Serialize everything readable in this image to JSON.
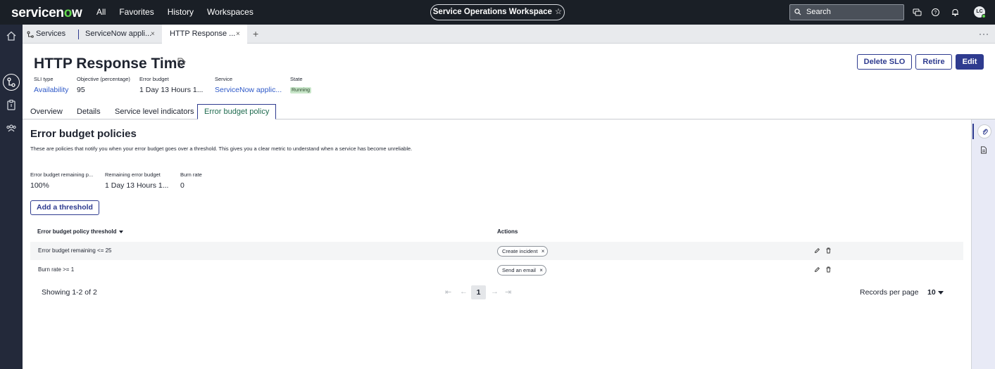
{
  "app": {
    "logo_text_a": "servicen",
    "logo_text_o": "o",
    "logo_text_b": "w",
    "nav": [
      "All",
      "Favorites",
      "History",
      "Workspaces"
    ],
    "workspace_pill": "Service Operations Workspace",
    "search_placeholder": "Search",
    "avatar_initials": "LC",
    "brand_color": "#62d84e",
    "accent_color": "#2e3b8f"
  },
  "tabs": {
    "items": [
      {
        "label": "Services",
        "icon": "services-icon"
      },
      {
        "label": "ServiceNow appli...",
        "close": "×"
      },
      {
        "label": "HTTP Response ...",
        "close": "×"
      },
      {
        "label": "+"
      }
    ],
    "more": "···"
  },
  "record": {
    "title": "HTTP Response Time",
    "fields": [
      {
        "label": "SLI type",
        "value": "Availability"
      },
      {
        "label": "Objective (percentage)",
        "value": "95"
      },
      {
        "label": "Error budget",
        "value": "1 Day 13 Hours 1..."
      },
      {
        "label": "Service",
        "value": "ServiceNow applic..."
      },
      {
        "label": "State",
        "value": "Running"
      }
    ],
    "actions": {
      "delete": "Delete SLO",
      "retire": "Retire",
      "edit": "Edit"
    }
  },
  "page_tabs": [
    "Overview",
    "Details",
    "Service level indicators",
    "Error budget policy"
  ],
  "policies": {
    "heading": "Error budget policies",
    "description": "These are policies that notify you when your error budget goes over a threshold. This gives you a clear metric to understand when a service has become unreliable.",
    "stats": [
      {
        "label": "Error budget remaining p...",
        "value": "100%"
      },
      {
        "label": "Remaining error budget",
        "value": "1 Day 13 Hours 1..."
      },
      {
        "label": "Burn rate",
        "value": "0"
      }
    ],
    "add_button": "Add a threshold",
    "columns": {
      "threshold": "Error budget policy threshold",
      "actions": "Actions"
    },
    "rows": [
      {
        "threshold": "Error budget remaining <= 25",
        "action": "Create incident"
      },
      {
        "threshold": "Burn rate >= 1",
        "action": "Send an email"
      }
    ],
    "chip_close": "×",
    "showing": "Showing 1-2 of 2",
    "pagination": {
      "first": "⇤",
      "prev": "←",
      "current": "1",
      "next": "→",
      "last": "⇥"
    },
    "records_per_page_label": "Records per page",
    "records_per_page": "10"
  }
}
